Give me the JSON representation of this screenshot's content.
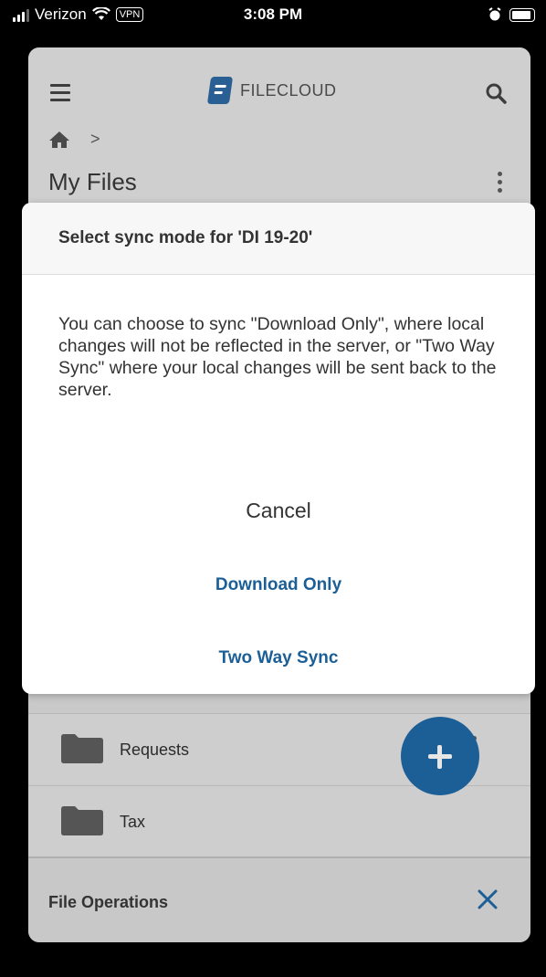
{
  "status_bar": {
    "carrier": "Verizon",
    "vpn": "VPN",
    "time": "3:08 PM"
  },
  "app": {
    "logo_text": "FILECLOUD",
    "breadcrumb_separator": ">",
    "page_title": "My Files",
    "brand_color": "#1c5f96"
  },
  "files": [
    {
      "name": "Requests"
    },
    {
      "name": "Tax"
    }
  ],
  "file_operations": {
    "label": "File Operations"
  },
  "dialog": {
    "title": "Select sync mode for 'DI 19-20'",
    "message": "You can choose to sync \"Download Only\", where local changes will not be reflected in the server, or \"Two Way Sync\" where your local changes will be sent back to the server.",
    "cancel_label": "Cancel",
    "download_only_label": "Download Only",
    "two_way_label": "Two Way Sync"
  }
}
